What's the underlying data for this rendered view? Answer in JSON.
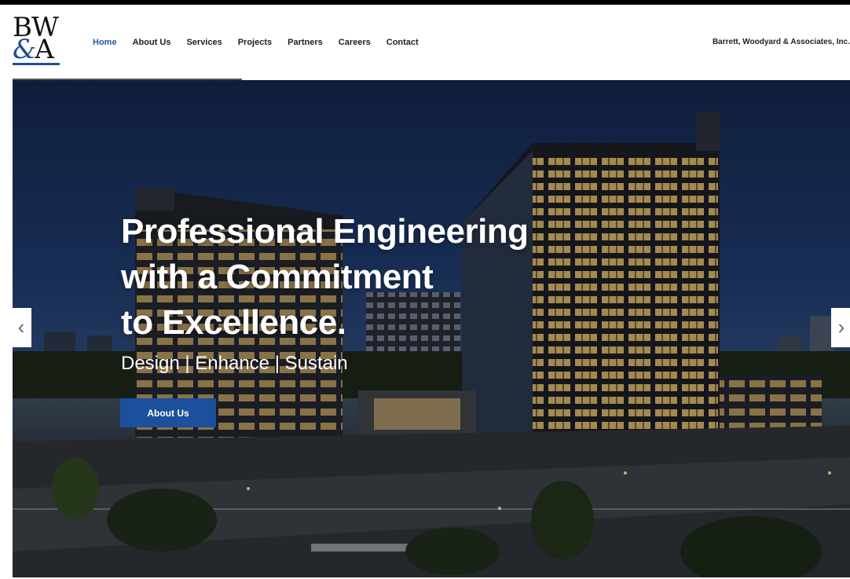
{
  "logo": {
    "line1": "BW",
    "amp": "&",
    "letter": "A"
  },
  "nav": {
    "items": [
      "Home",
      "About Us",
      "Services",
      "Projects",
      "Partners",
      "Careers",
      "Contact"
    ],
    "active": "Home"
  },
  "company_name": "Barrett, Woodyard & Associates, Inc.",
  "hero": {
    "headline_lines": [
      "Professional Engineering",
      "with a Commitment",
      "to Excellence."
    ],
    "tagline": "Design | Enhance | Sustain",
    "cta_label": "About Us",
    "prev_arrow": "‹",
    "next_arrow": "›"
  },
  "colors": {
    "brand_blue": "#1c4f9c",
    "active_nav": "#1c5aa8"
  }
}
